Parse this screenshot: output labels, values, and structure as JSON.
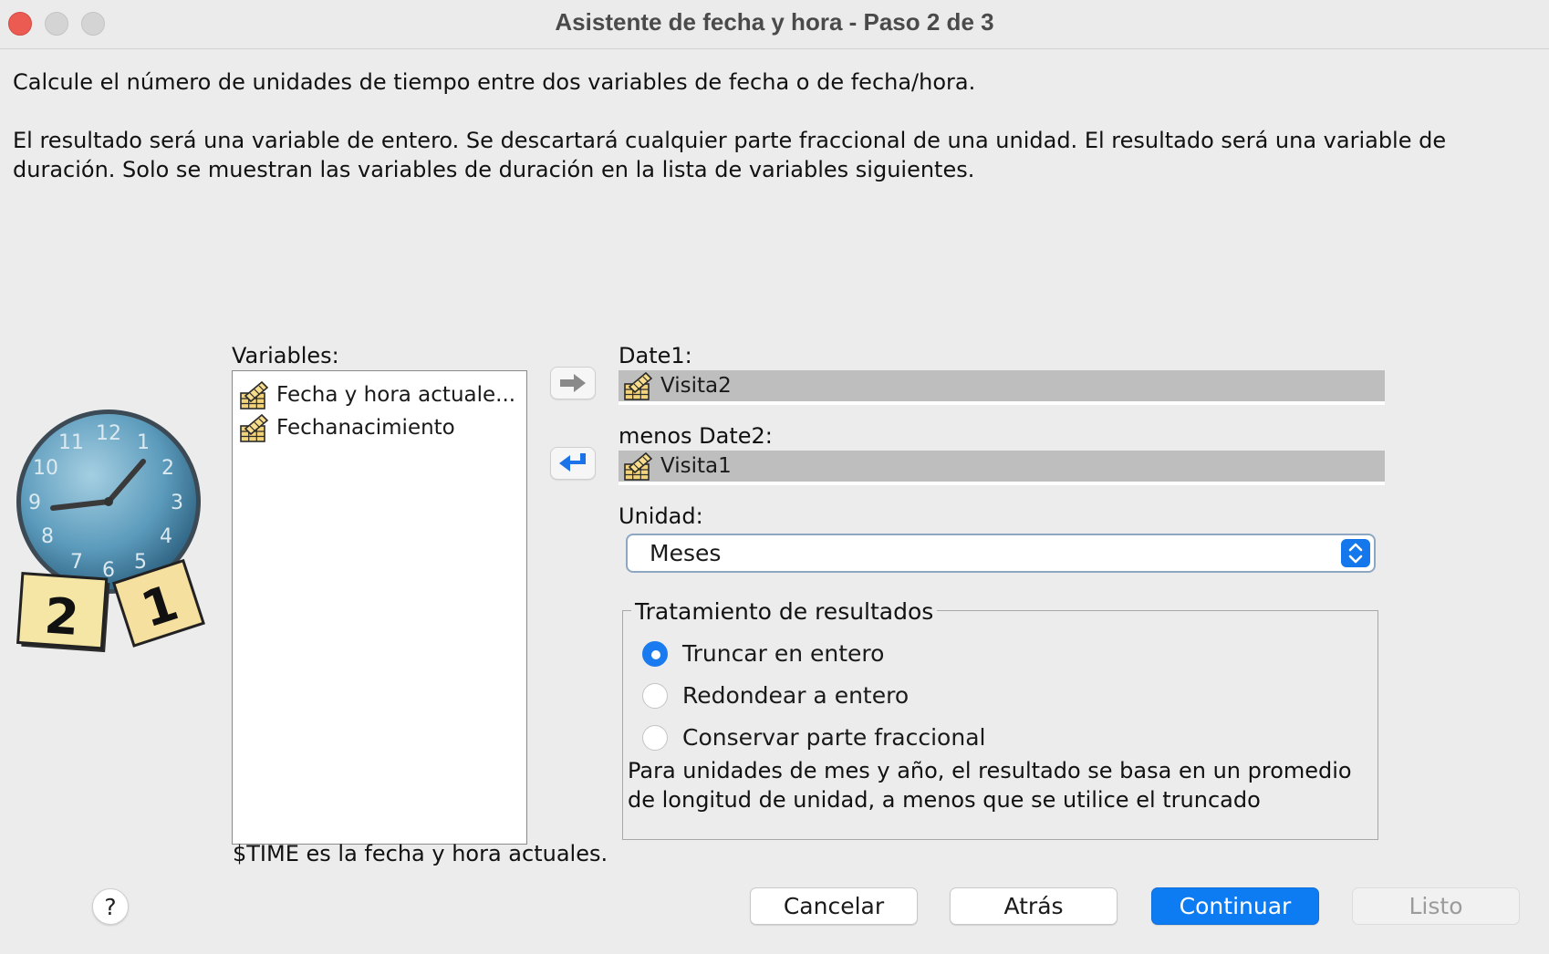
{
  "window": {
    "title": "Asistente de fecha y hora - Paso 2 de 3"
  },
  "description": {
    "line1": "Calcule el número de unidades de tiempo entre dos variables de fecha o de fecha/hora.",
    "line2": "El resultado será una variable de entero. Se descartará cualquier parte fraccional de una unidad. El resultado será una variable de duración. Solo se muestran las variables de duración en la lista de variables siguientes."
  },
  "variables": {
    "label": "Variables:",
    "items": [
      {
        "label": "Fecha y hora actuale...",
        "icon": "date-variable-icon"
      },
      {
        "label": "Fechanacimiento",
        "icon": "date-variable-icon"
      }
    ],
    "footnote": "$TIME es la fecha y hora actuales."
  },
  "date1": {
    "label": "Date1:",
    "value": "Visita2",
    "icon": "date-variable-icon"
  },
  "date2": {
    "label": "menos Date2:",
    "value": "Visita1",
    "icon": "date-variable-icon"
  },
  "unit": {
    "label": "Unidad:",
    "selected": "Meses"
  },
  "result_treatment": {
    "legend": "Tratamiento de resultados",
    "options": [
      {
        "label": "Truncar en entero",
        "selected": true
      },
      {
        "label": "Redondear a entero",
        "selected": false
      },
      {
        "label": "Conservar parte fraccional",
        "selected": false
      }
    ],
    "note": "Para unidades de mes y año, el resultado se basa en un promedio de longitud de unidad, a menos que se utilice el truncado"
  },
  "buttons": {
    "help": "?",
    "cancel": "Cancelar",
    "back": "Atrás",
    "continue": "Continuar",
    "done": "Listo"
  },
  "colors": {
    "accent": "#0d7cf2",
    "close": "#ec5b52",
    "target_bg": "#bebebe",
    "arrow_blue": "#1a73e8"
  }
}
